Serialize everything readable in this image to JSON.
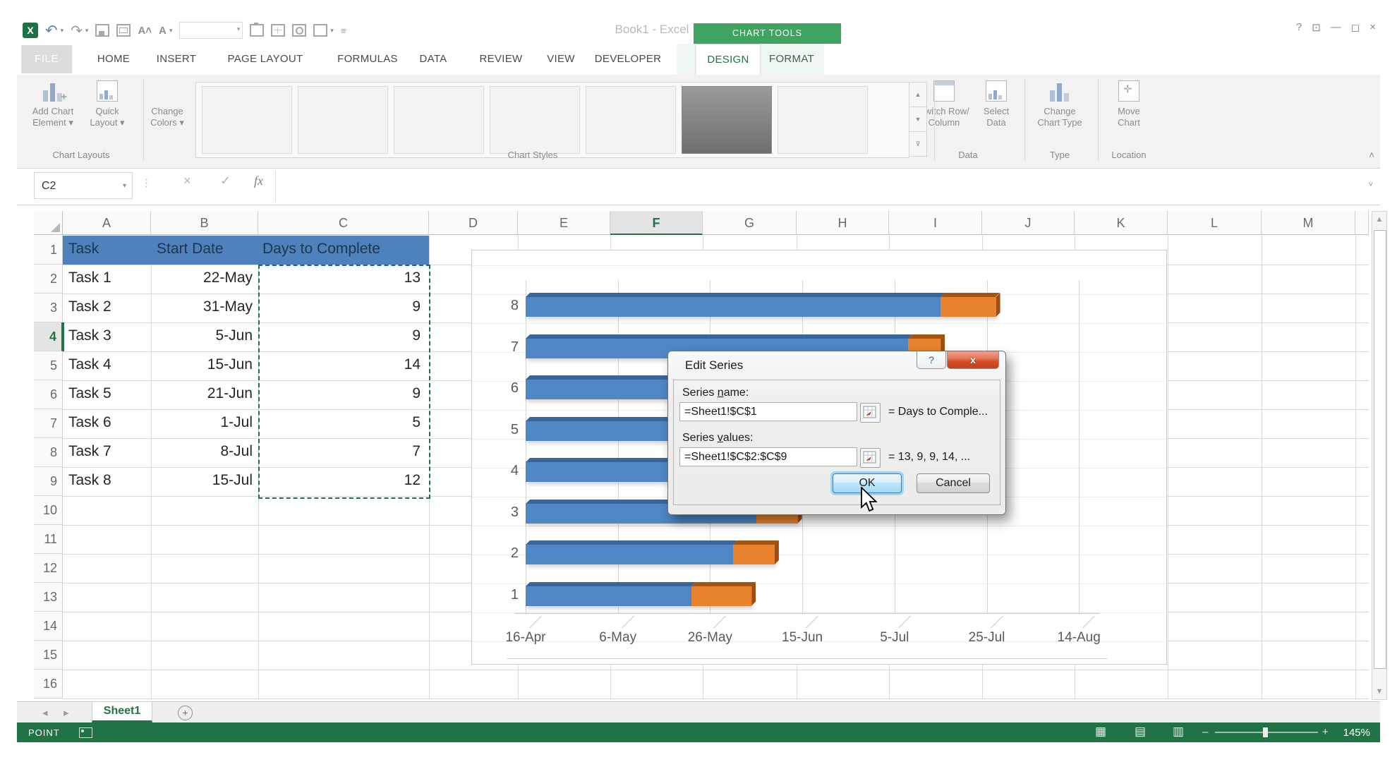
{
  "titlebar": {
    "title": "Book1 - Excel",
    "chart_tools_label": "CHART TOOLS",
    "qat_icons": [
      "excel-logo",
      "undo",
      "redo",
      "save",
      "email",
      "font-increase",
      "font-color",
      "font-box",
      "clipboard",
      "table",
      "print-preview",
      "shapes",
      "customize-quick-access"
    ],
    "window_controls": [
      "help",
      "ribbon-options",
      "minimize",
      "restore",
      "close"
    ],
    "window_control_glyphs": {
      "help": "?",
      "ribbon": "⊡",
      "minimize": "—",
      "restore": "◻",
      "close": "×"
    }
  },
  "tabs": {
    "file": "FILE",
    "items": [
      "HOME",
      "INSERT",
      "PAGE LAYOUT",
      "FORMULAS",
      "DATA",
      "REVIEW",
      "VIEW",
      "DEVELOPER",
      "DESIGN",
      "FORMAT"
    ],
    "active": "DESIGN",
    "contextual": [
      "DESIGN",
      "FORMAT"
    ]
  },
  "ribbon": {
    "buttons": [
      {
        "id": "add-chart-element",
        "lines": [
          "Add Chart",
          "Element ▾"
        ],
        "icon": "bars-plus"
      },
      {
        "id": "quick-layout",
        "lines": [
          "Quick",
          "Layout ▾"
        ],
        "icon": "layout-box"
      },
      {
        "id": "change-colors",
        "lines": [
          "Change",
          "Colors ▾"
        ],
        "icon": "color-dots"
      },
      {
        "id": "switch-row-column",
        "lines": [
          "Switch Row/",
          "Column"
        ],
        "icon": "table-swap"
      },
      {
        "id": "select-data",
        "lines": [
          "Select",
          "Data"
        ],
        "icon": "table-chart"
      },
      {
        "id": "change-chart-type",
        "lines": [
          "Change",
          "Chart Type"
        ],
        "icon": "bars"
      },
      {
        "id": "move-chart",
        "lines": [
          "Move",
          "Chart"
        ],
        "icon": "chart-move"
      }
    ],
    "group_labels": [
      "Chart Layouts",
      "Chart Styles",
      "Data",
      "Type",
      "Location"
    ],
    "gallery": {
      "thumb_count": 7,
      "dark_index": 5
    }
  },
  "formula_bar": {
    "name_box": "C2",
    "cancel": "×",
    "enter": "✓",
    "fx": "fx",
    "value": ""
  },
  "grid": {
    "columns": [
      "A",
      "B",
      "C",
      "D",
      "E",
      "F",
      "G",
      "H",
      "I",
      "J",
      "K",
      "L",
      "M"
    ],
    "rows": 16,
    "selected_column": "F",
    "selected_row": 4,
    "table": {
      "header_fill": "#4F81BD",
      "headers": [
        "Task",
        "Start Date",
        "Days to Complete"
      ],
      "rows": [
        [
          "Task 1",
          "22-May",
          "13"
        ],
        [
          "Task 2",
          "31-May",
          "9"
        ],
        [
          "Task 3",
          "5-Jun",
          "9"
        ],
        [
          "Task 4",
          "15-Jun",
          "14"
        ],
        [
          "Task 5",
          "21-Jun",
          "9"
        ],
        [
          "Task 6",
          "1-Jul",
          "5"
        ],
        [
          "Task 7",
          "8-Jul",
          "7"
        ],
        [
          "Task 8",
          "15-Jul",
          "12"
        ]
      ]
    }
  },
  "chart_data": {
    "type": "bar",
    "subtype": "stacked-horizontal-3d",
    "title": "",
    "legend": "none",
    "categories": [
      "8",
      "7",
      "6",
      "5",
      "4",
      "3",
      "2",
      "1"
    ],
    "series": [
      {
        "name": "Start Date",
        "color": "#4E86C6",
        "color_dark": "#39679B",
        "values_days_offset": [
          90,
          83,
          76,
          66,
          60,
          50,
          45,
          36
        ]
      },
      {
        "name": "Days to Complete",
        "color": "#E8822E",
        "color_dark": "#A65511",
        "values": [
          12,
          7,
          5,
          9,
          14,
          9,
          9,
          13
        ]
      }
    ],
    "x_tick_labels": [
      "16-Apr",
      "6-May",
      "26-May",
      "15-Jun",
      "5-Jul",
      "25-Jul",
      "14-Aug"
    ],
    "x_axis": {
      "min_label": "16-Apr",
      "max_label": "14-Aug",
      "interval_days": 20,
      "range_days": 120
    },
    "gridlines": "vertical"
  },
  "dialog": {
    "title": "Edit Series",
    "help_label": "?",
    "close_label": "x",
    "series_name_label_pre": "Series ",
    "series_name_key": "n",
    "series_name_label_rest": "ame:",
    "series_name_value": "=Sheet1!$C$1",
    "series_name_preview": "= Days to Comple...",
    "series_values_label_pre": "Series ",
    "series_values_key": "v",
    "series_values_label_rest": "alues:",
    "series_values_value": "=Sheet1!$C$2:$C$9",
    "series_values_preview": "= 13, 9, 9, 14, ...",
    "ok_label": "OK",
    "cancel_label": "Cancel"
  },
  "sheet_bar": {
    "prev": "◂",
    "next": "▸",
    "active_tab": "Sheet1",
    "add_sheet": "+"
  },
  "status_bar": {
    "mode": "POINT",
    "icons": [
      "macro-record",
      "normal-view",
      "page-layout-view",
      "page-break-view"
    ],
    "view_glyphs": [
      "▦",
      "▤",
      "▥"
    ],
    "zoom_minus": "–",
    "zoom_plus": "+",
    "zoom_level": "145%"
  },
  "scrollbars": {
    "up": "▲",
    "down": "▼",
    "left": "◂",
    "right": "▸"
  }
}
